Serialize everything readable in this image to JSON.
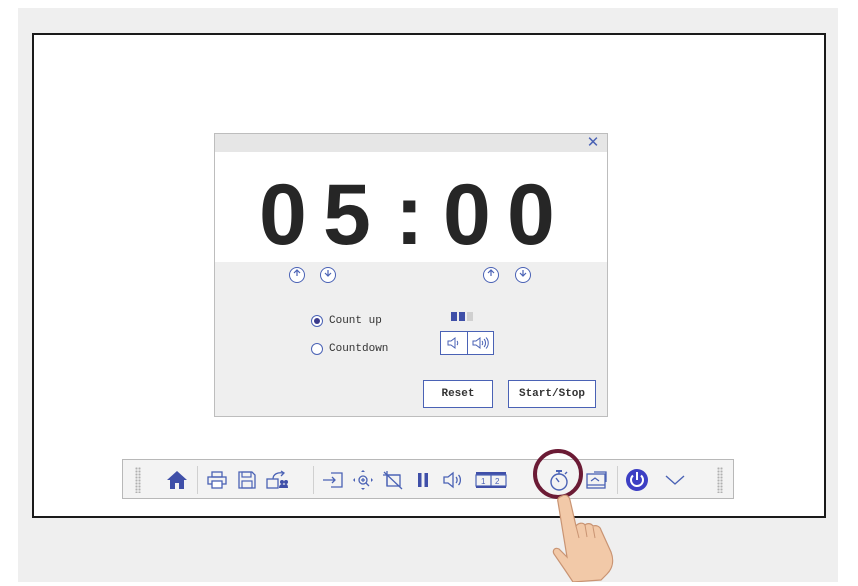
{
  "timer": {
    "digits": [
      "0",
      "5",
      ":",
      "0",
      "0"
    ],
    "close_icon": "close-icon",
    "up_icon": "arrow-up-circle-icon",
    "down_icon": "arrow-down-circle-icon",
    "modes": [
      {
        "label": "Count up",
        "selected": true
      },
      {
        "label": "Countdown",
        "selected": false
      }
    ],
    "volume_level": 2,
    "volume_levels_total": 3,
    "reset_label": "Reset",
    "start_stop_label": "Start/Stop"
  },
  "toolbar": {
    "items": [
      {
        "name": "home-icon",
        "label": "Home"
      },
      {
        "name": "print-icon",
        "label": "Print"
      },
      {
        "name": "save-icon",
        "label": "Save"
      },
      {
        "name": "share-icon",
        "label": "Share"
      },
      {
        "name": "input-source-icon",
        "label": "Input"
      },
      {
        "name": "zoom-move-icon",
        "label": "Zoom"
      },
      {
        "name": "freeze-off-icon",
        "label": "Freeze"
      },
      {
        "name": "pause-icon",
        "label": "Pause"
      },
      {
        "name": "volume-icon",
        "label": "Volume"
      },
      {
        "name": "split-screen-icon",
        "label": "Split"
      },
      {
        "name": "timer-icon",
        "label": "Timer"
      },
      {
        "name": "screenshot-icon",
        "label": "Capture"
      },
      {
        "name": "power-icon",
        "label": "Power"
      },
      {
        "name": "chevron-down-icon",
        "label": "More"
      }
    ]
  },
  "colors": {
    "accent": "#4a62b5",
    "power": "#3d3fc4",
    "highlight": "#6b1b35",
    "digits": "#262626"
  }
}
